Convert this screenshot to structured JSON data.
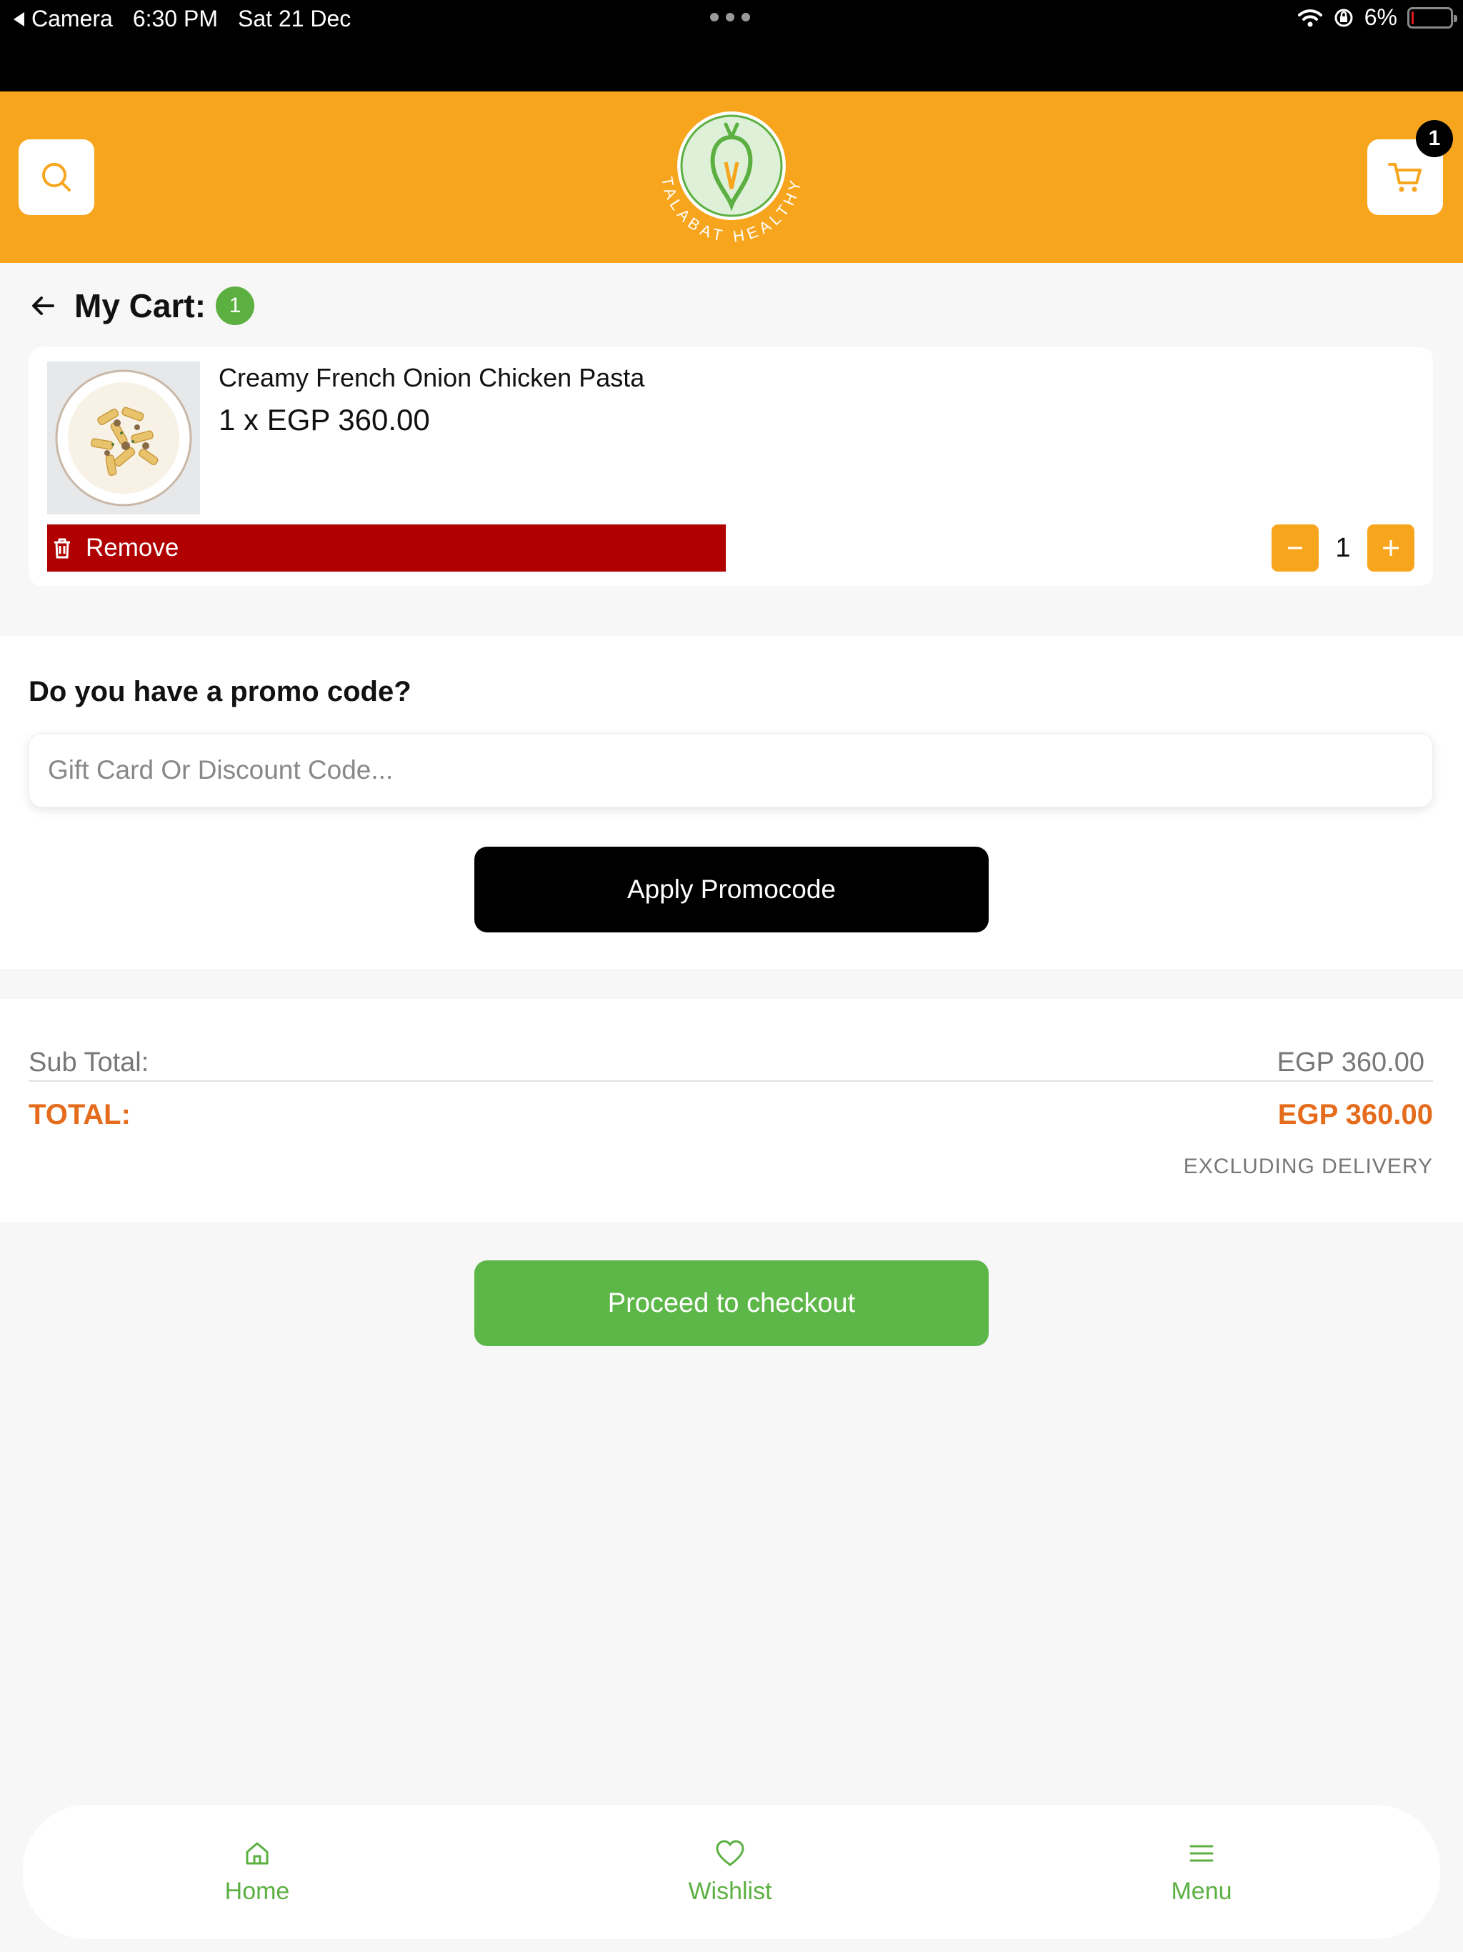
{
  "status_bar": {
    "back_app": "Camera",
    "time": "6:30 PM",
    "date": "Sat 21 Dec",
    "battery": "6%",
    "battery_level": 0.06
  },
  "header": {
    "logo_text": "TALABAT HEALTHY",
    "cart_count": "1",
    "brand_color": "#f8a51e"
  },
  "cart": {
    "title": "My Cart:",
    "count": "1",
    "items": [
      {
        "name": "Creamy French Onion Chicken Pasta",
        "price_line": "1 x EGP 360.00",
        "remove_label": "Remove",
        "quantity": "1"
      }
    ]
  },
  "promo": {
    "question": "Do you have a promo code?",
    "placeholder": "Gift Card Or Discount Code...",
    "value": "",
    "apply_label": "Apply Promocode"
  },
  "totals": {
    "subtotal_label": "Sub Total:",
    "subtotal_value": "EGP 360.00",
    "total_label": "TOTAL:",
    "total_value": "EGP 360.00",
    "note": "EXCLUDING DELIVERY"
  },
  "checkout": {
    "label": "Proceed to checkout"
  },
  "bottom_nav": {
    "items": [
      {
        "label": "Home",
        "icon": "home-icon"
      },
      {
        "label": "Wishlist",
        "icon": "heart-icon"
      },
      {
        "label": "Menu",
        "icon": "menu-icon"
      }
    ]
  },
  "colors": {
    "accent_orange": "#f8a51e",
    "remove_red": "#b00000",
    "green": "#5cb042",
    "total_orange": "#e46c1c"
  }
}
